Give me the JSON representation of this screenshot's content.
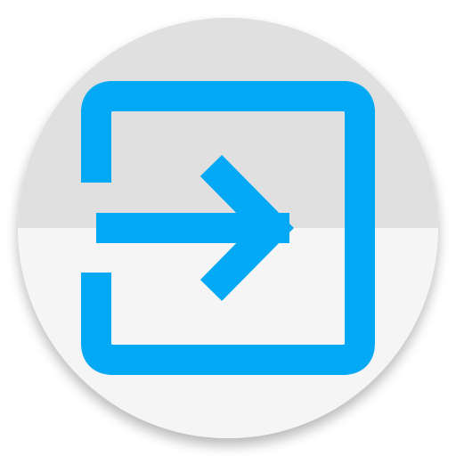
{
  "icon": {
    "name": "sign-in-icon",
    "colors": {
      "accent": "#03A9F4",
      "accent_dark": "#039BDB",
      "circle_top": "#E0E0E0",
      "circle_bottom": "#F5F5F5",
      "shadow": "#000000"
    }
  }
}
